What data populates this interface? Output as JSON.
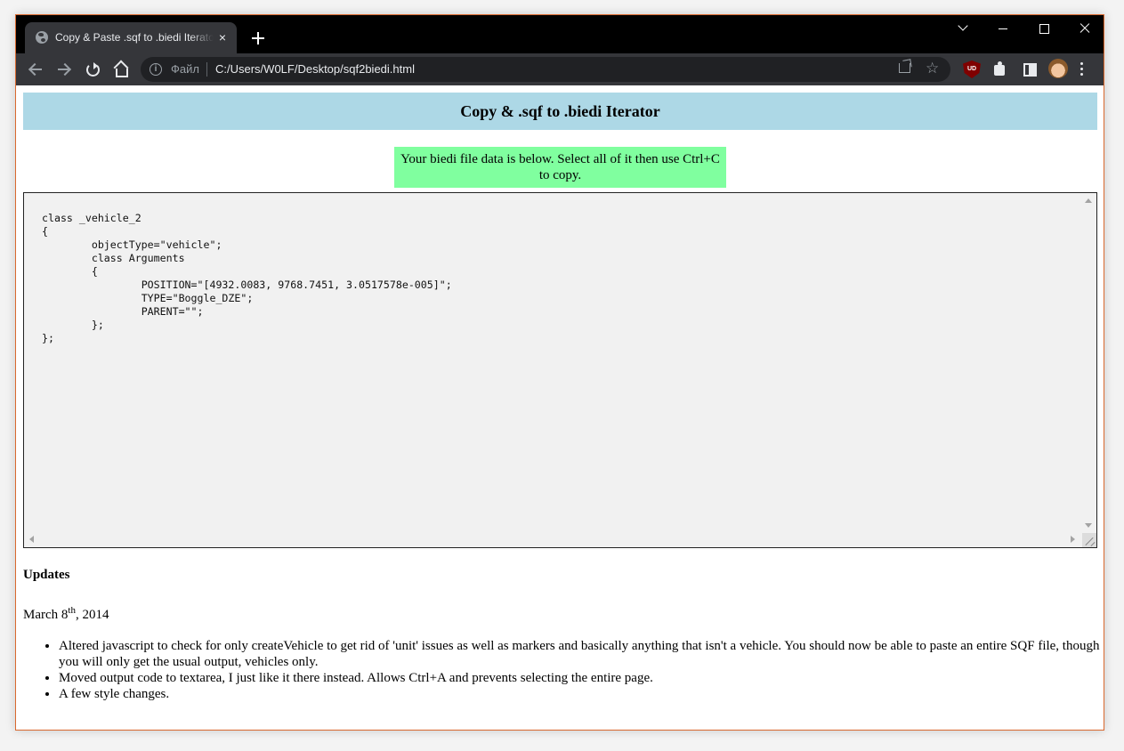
{
  "browser": {
    "tab": {
      "title": "Copy & Paste .sqf to .biedi Iterator",
      "close": "×"
    },
    "address": {
      "info": "i",
      "scheme": "Файл",
      "url": "C:/Users/W0LF/Desktop/sqf2biedi.html"
    },
    "star": "☆",
    "ublock_label": "UD"
  },
  "page": {
    "header_title": "Copy & .sqf to .biedi Iterator",
    "notice": "Your biedi file data is below. Select all of it then use Ctrl+C to copy.",
    "code": "class _vehicle_2\n{\n\tobjectType=\"vehicle\";\n\tclass Arguments\n\t{\n\t\tPOSITION=\"[4932.0083, 9768.7451, 3.0517578e-005]\";\n\t\tTYPE=\"Boggle_DZE\";\n\t\tPARENT=\"\";\n\t};\n};",
    "updates_heading": "Updates",
    "update_date": {
      "month_day": "March 8",
      "suffix": "th",
      "year": ", 2014"
    },
    "update_items": [
      "Altered javascript to check for only createVehicle to get rid of 'unit' issues as well as markers and basically anything that isn't a vehicle. You should now be able to paste an entire SQF file, though you will only get the usual output, vehicles only.",
      "Moved output code to textarea, I just like it there instead. Allows Ctrl+A and prevents selecting the entire page.",
      "A few style changes."
    ]
  }
}
